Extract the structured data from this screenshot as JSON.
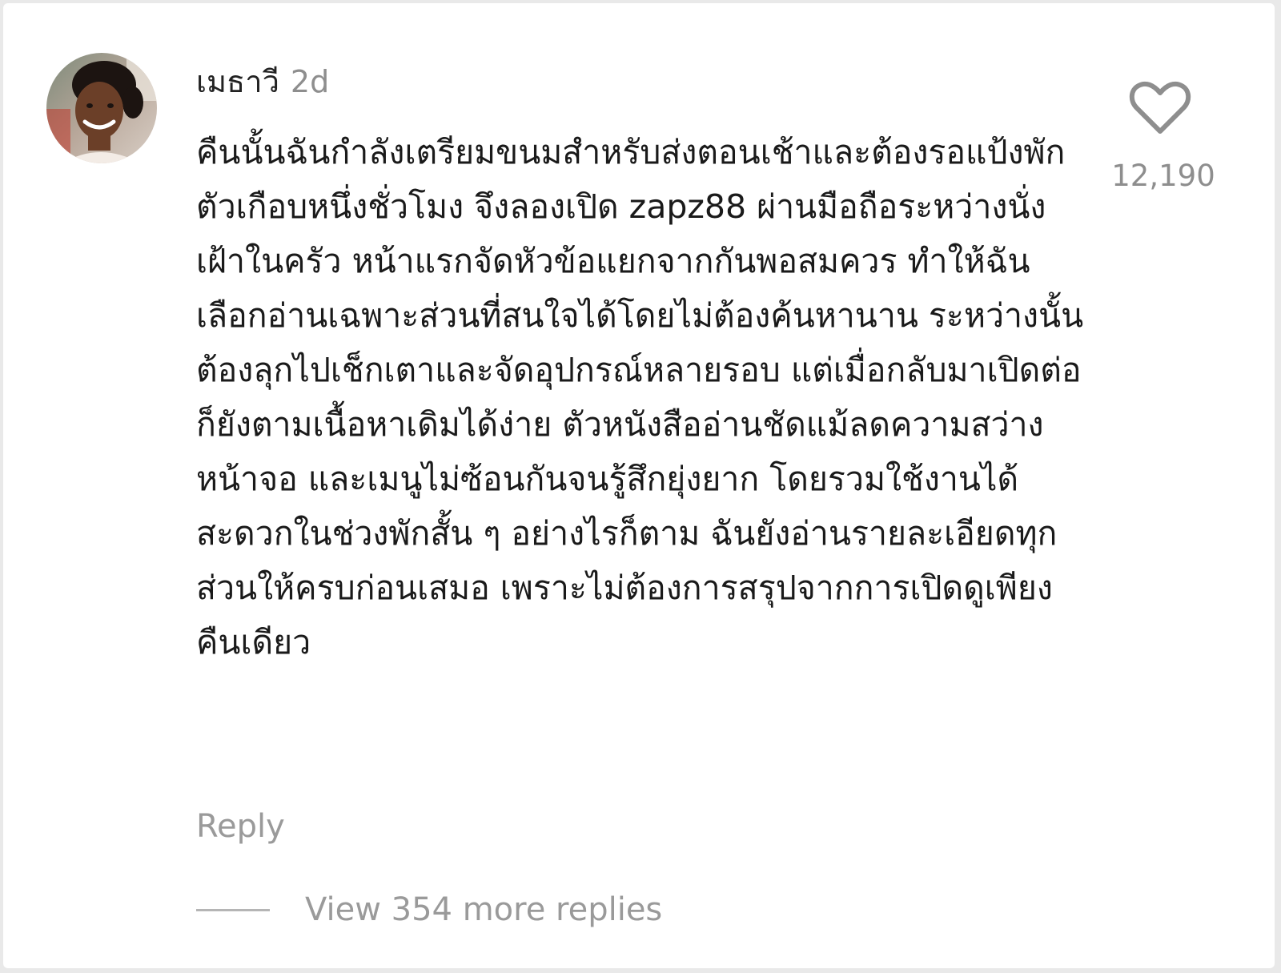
{
  "comment": {
    "username": "เมธาวี",
    "time": "2d",
    "avatar_icon": "user-avatar-photo",
    "text": "คืนนั้นฉันกำลังเตรียมขนมสำหรับส่งตอนเช้าและต้องรอแป้งพักตัวเกือบหนึ่งชั่วโมง จึงลองเปิด zapz88 ผ่านมือถือระหว่างนั่งเฝ้าในครัว หน้าแรกจัดหัวข้อแยกจากกันพอสมควร ทำให้ฉันเลือกอ่านเฉพาะส่วนที่สนใจได้โดยไม่ต้องค้นหานาน ระหว่างนั้นต้องลุกไปเช็กเตาและจัดอุปกรณ์หลายรอบ แต่เมื่อกลับมาเปิดต่อก็ยังตามเนื้อหาเดิมได้ง่าย ตัวหนังสืออ่านชัดแม้ลดความสว่างหน้าจอ และเมนูไม่ซ้อนกันจนรู้สึกยุ่งยาก โดยรวมใช้งานได้สะดวกในช่วงพักสั้น ๆ อย่างไรก็ตาม ฉันยังอ่านรายละเอียดทุกส่วนให้ครบก่อนเสมอ เพราะไม่ต้องการสรุปจากการเปิดดูเพียงคืนเดียว",
    "reply_label": "Reply",
    "like_icon": "heart-outline-icon",
    "like_count": "12,190",
    "view_replies_label": "View 354 more replies"
  },
  "colors": {
    "text_primary": "#1a1a1a",
    "text_secondary": "#8e8e8e",
    "background": "#ffffff"
  }
}
